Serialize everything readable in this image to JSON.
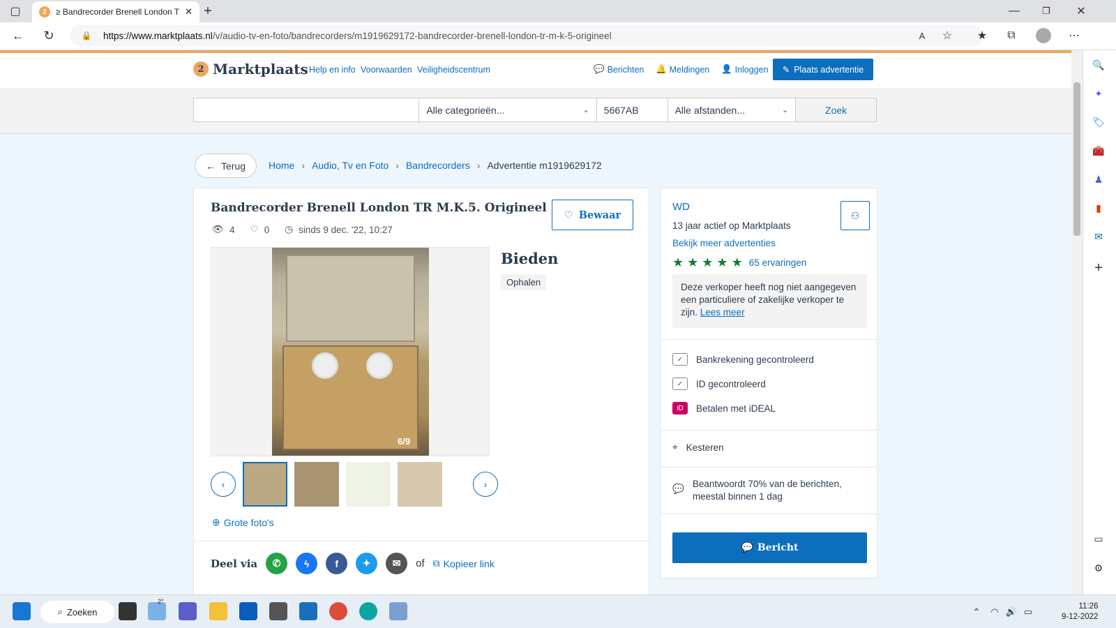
{
  "browser": {
    "tab_title": "≥ Bandrecorder Brenell London T",
    "tab_favicon": "2",
    "url_host": "https://www.marktplaats.nl",
    "url_path": "/v/audio-tv-en-foto/bandrecorders/m1919629172-bandrecorder-brenell-london-tr-m-k-5-origineel"
  },
  "header": {
    "logo_text": "Marktplaats",
    "logo_badge": "2",
    "links": [
      "Help en info",
      "Voorwaarden",
      "Veiligheidscentrum"
    ],
    "berichten": "Berichten",
    "meldingen": "Meldingen",
    "inloggen": "Inloggen",
    "plaats": "Plaats advertentie"
  },
  "search": {
    "query": "",
    "category": "Alle categorieën...",
    "postcode": "5667AB",
    "distance": "Alle afstanden...",
    "button": "Zoek"
  },
  "nav": {
    "back": "Terug",
    "crumbs": [
      "Home",
      "Audio, Tv en Foto",
      "Bandrecorders",
      "Advertentie m1919629172"
    ]
  },
  "listing": {
    "title": "Bandrecorder Brenell London TR M.K.5. Origineel",
    "views": "4",
    "favorites": "0",
    "since": "sinds 9 dec. '22, 10:27",
    "save": "Bewaar",
    "photo_counter": "6/9",
    "price": "Bieden",
    "delivery": "Ophalen",
    "large_photos": "Grote foto's",
    "share_label": "Deel via",
    "share_or": "of",
    "copy_link": "Kopieer link"
  },
  "seller": {
    "name": "WD",
    "active": "13 jaar actief op Marktplaats",
    "more_ads": "Bekijk meer advertenties",
    "rating_stars": 5,
    "reviews": "65 ervaringen",
    "notice": "Deze verkoper heeft nog niet aangegeven een particuliere of zakelijke verkoper te zijn.",
    "notice_link": "Lees meer",
    "verifications": [
      "Bankrekening gecontroleerd",
      "ID gecontroleerd",
      "Betalen met iDEAL"
    ],
    "location": "Kesteren",
    "response": "Beantwoordt 70% van de berichten,",
    "response2": "meestal binnen 1 dag",
    "message_button": "Bericht"
  },
  "taskbar": {
    "search": "Zoeken",
    "weather": "2°",
    "time": "11:26",
    "date": "9-12-2022"
  },
  "colors": {
    "brand_blue": "#0c6ebd",
    "brand_orange": "#eda566",
    "star_green": "#1b7a2e"
  }
}
